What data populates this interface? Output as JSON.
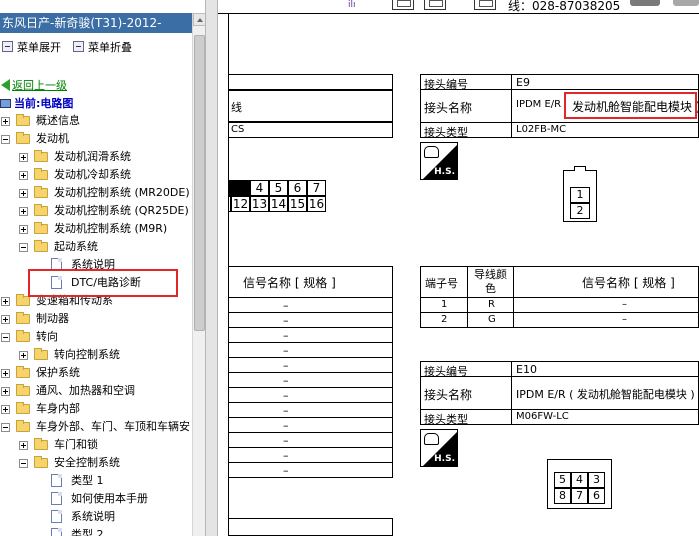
{
  "window": {
    "title": "东风日产-新奇骏(T31)-2012-"
  },
  "toolbar": {
    "expand_all": "菜单展开",
    "collapse_all": "菜单折叠"
  },
  "nav": {
    "back": "返回上一级",
    "current": "当前:电路图"
  },
  "tree": [
    {
      "label": "概述信息",
      "type": "folder",
      "expander": "plus",
      "depth": 0
    },
    {
      "label": "发动机",
      "type": "folder",
      "expander": "minus",
      "depth": 0
    },
    {
      "label": "发动机润滑系统",
      "type": "folder",
      "expander": "plus",
      "depth": 1
    },
    {
      "label": "发动机冷却系统",
      "type": "folder",
      "expander": "plus",
      "depth": 1
    },
    {
      "label": "发动机控制系统 (MR20DE)",
      "type": "folder",
      "expander": "plus",
      "depth": 1
    },
    {
      "label": "发动机控制系统 (QR25DE)",
      "type": "folder",
      "expander": "plus",
      "depth": 1
    },
    {
      "label": "发动机控制系统 (M9R)",
      "type": "folder",
      "expander": "plus",
      "depth": 1
    },
    {
      "label": "起动系统",
      "type": "folder",
      "expander": "minus",
      "depth": 1
    },
    {
      "label": "系统说明",
      "type": "doc",
      "depth": 2
    },
    {
      "label": "DTC/电路诊断",
      "type": "doc",
      "depth": 2,
      "selected": true
    },
    {
      "label": "变速箱和传动系",
      "type": "folder",
      "expander": "plus",
      "depth": 0
    },
    {
      "label": "制动器",
      "type": "folder",
      "expander": "plus",
      "depth": 0
    },
    {
      "label": "转向",
      "type": "folder",
      "expander": "minus",
      "depth": 0
    },
    {
      "label": "转向控制系统",
      "type": "folder",
      "expander": "plus",
      "depth": 1
    },
    {
      "label": "保护系统",
      "type": "folder",
      "expander": "plus",
      "depth": 0
    },
    {
      "label": "通风、加热器和空调",
      "type": "folder",
      "expander": "plus",
      "depth": 0
    },
    {
      "label": "车身内部",
      "type": "folder",
      "expander": "plus",
      "depth": 0
    },
    {
      "label": "车身外部、车门、车顶和车辆安",
      "type": "folder",
      "expander": "minus",
      "depth": 0
    },
    {
      "label": "车门和锁",
      "type": "folder",
      "expander": "plus",
      "depth": 1
    },
    {
      "label": "安全控制系统",
      "type": "folder",
      "expander": "minus",
      "depth": 1
    },
    {
      "label": "类型 1",
      "type": "doc",
      "depth": 2
    },
    {
      "label": "如何使用本手册",
      "type": "doc",
      "depth": 2
    },
    {
      "label": "系统说明",
      "type": "doc",
      "depth": 2
    },
    {
      "label": "类型 2",
      "type": "doc",
      "depth": 2
    }
  ],
  "topbar": {
    "phone": "线：028-87038205",
    "logo": "ilı"
  },
  "left_partial": {
    "row1": "线",
    "row2": "CS",
    "pins_top": [
      "4",
      "5",
      "6",
      "7"
    ],
    "pins_bottom": [
      "12",
      "13",
      "14",
      "15",
      "16"
    ],
    "signal_header": "信号名称 [ 规格 ]",
    "dashes": [
      "–",
      "–",
      "–",
      "–",
      "–",
      "–",
      "–",
      "–",
      "–",
      "–",
      "–",
      "–"
    ]
  },
  "connector_e9": {
    "no_label": "接头编号",
    "no_value": "E9",
    "name_label": "接头名称",
    "name_value": "IPDM E/R",
    "name_value_highlight": "发动机舱智能配电模块 )",
    "type_label": "接头类型",
    "type_value": "L02FB-MC",
    "hs": "H.S.",
    "pins": [
      "1",
      "2"
    ],
    "table_headers": [
      "端子号",
      "导线颜色",
      "信号名称 [ 规格 ]"
    ],
    "rows": [
      {
        "terminal": "1",
        "color": "R",
        "signal": "–"
      },
      {
        "terminal": "2",
        "color": "G",
        "signal": "–"
      }
    ]
  },
  "connector_e10": {
    "no_label": "接头编号",
    "no_value": "E10",
    "name_label": "接头名称",
    "name_value": "IPDM E/R ( 发动机舱智能配电模块 )",
    "type_label": "接头类型",
    "type_value": "M06FW-LC",
    "hs": "H.S.",
    "pins_top": [
      "5",
      "4",
      "3"
    ],
    "pins_bottom": [
      "8",
      "7",
      "6"
    ]
  }
}
